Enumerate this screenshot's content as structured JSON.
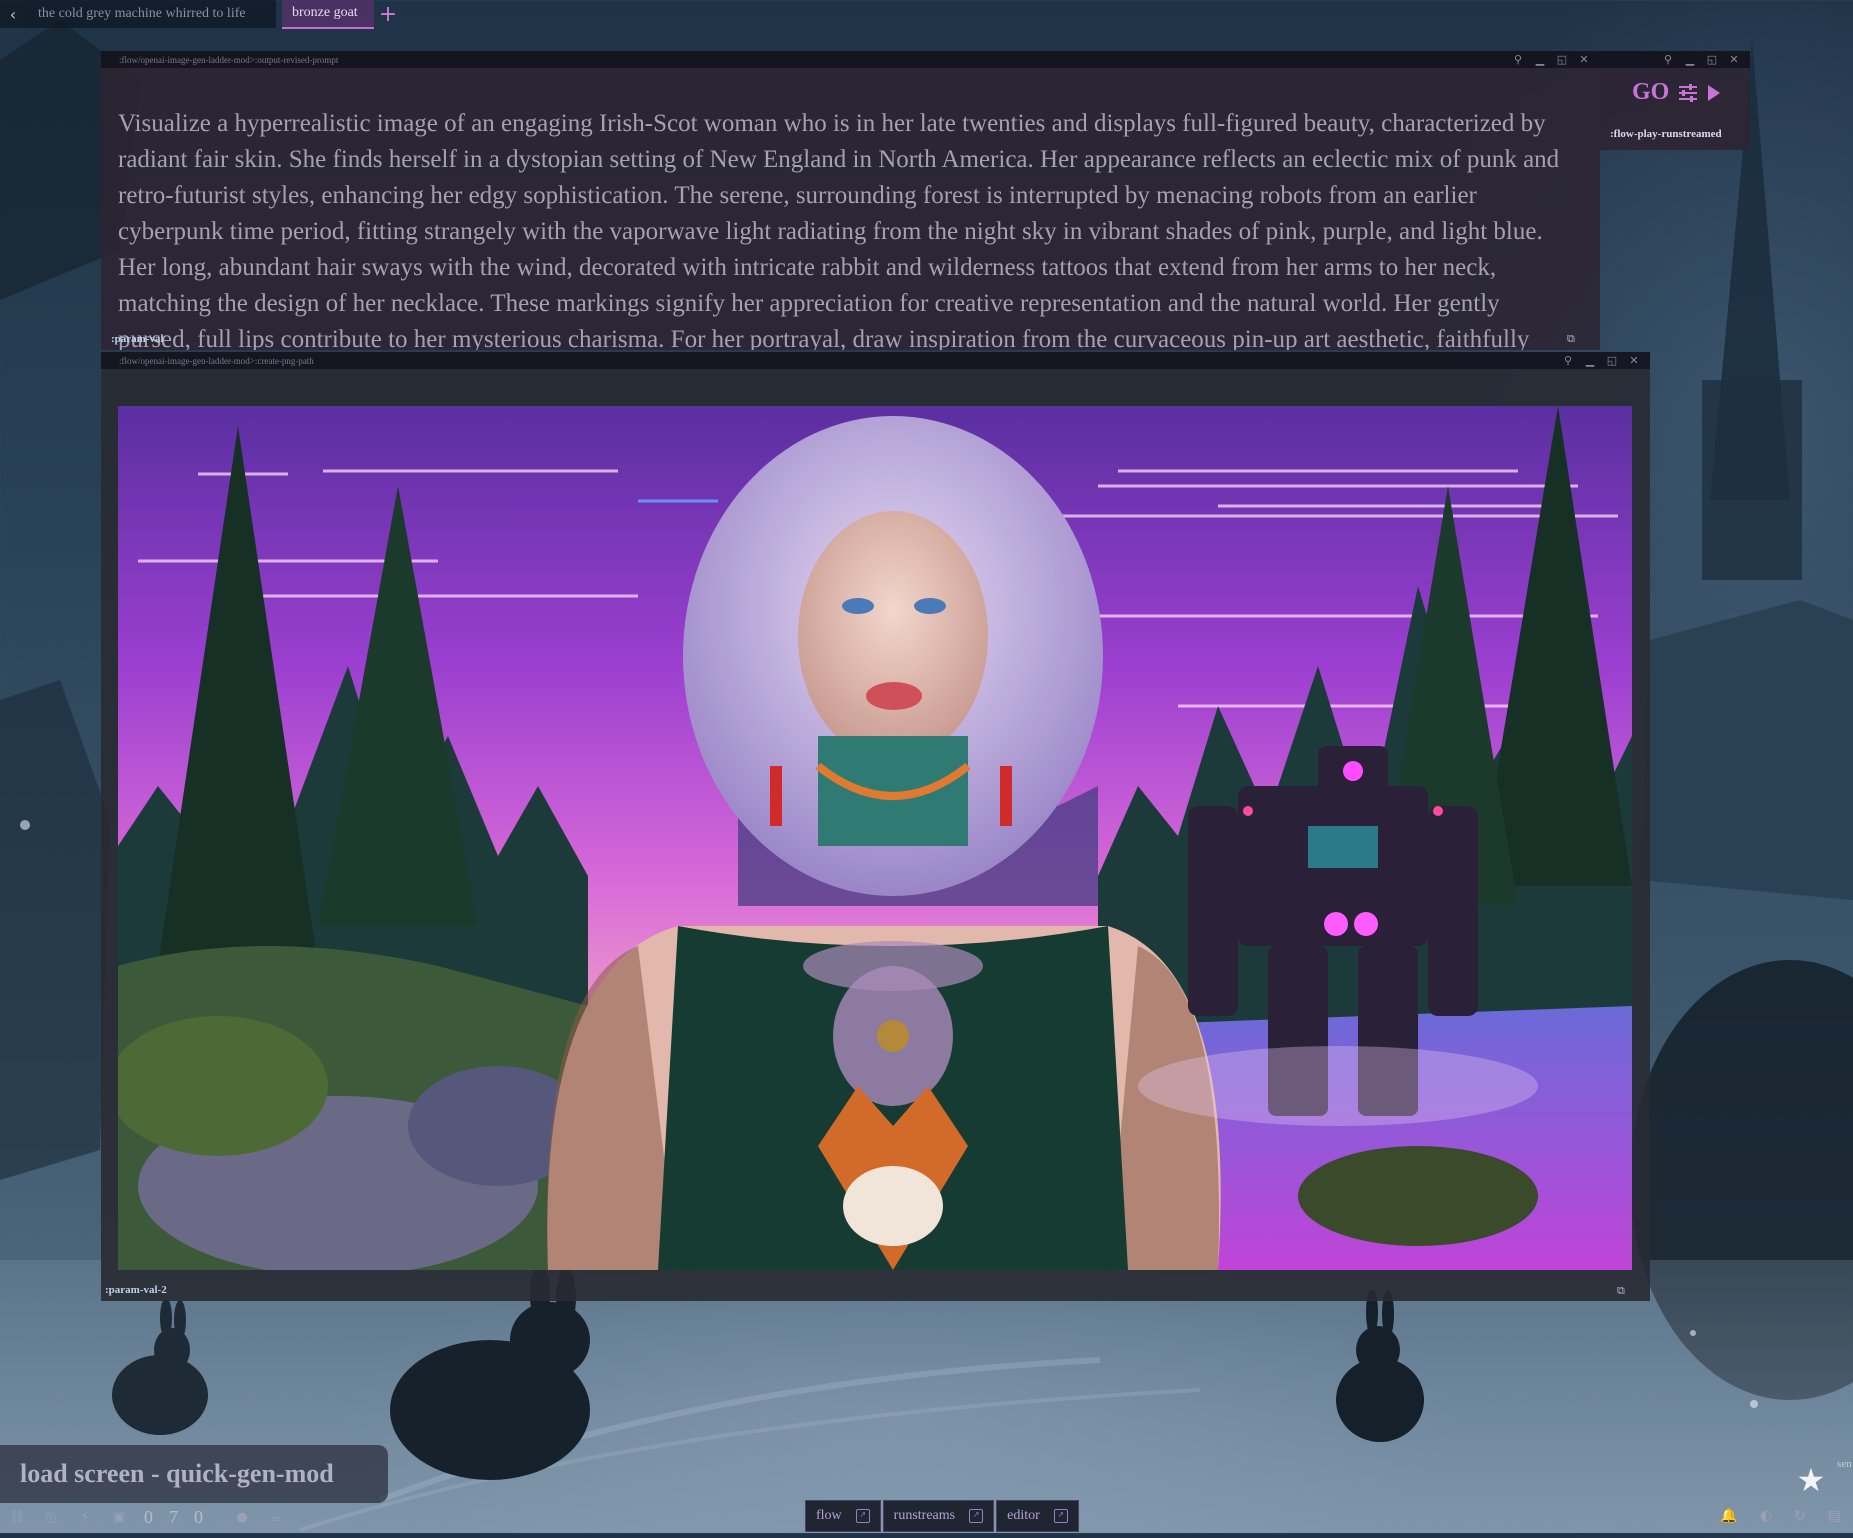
{
  "tabs": [
    {
      "label": "the cold grey machine whirred to life",
      "active": false
    },
    {
      "label": "bronze goat",
      "active": true
    }
  ],
  "tab_add_glyph": "+",
  "back_glyph": "‹",
  "prompt_panel": {
    "path": ":flow/openai-image-gen-ladder-mod>:output-revised-prompt",
    "text": "Visualize a hyperrealistic image of an engaging Irish-Scot woman who is in her late twenties and displays full-figured beauty, characterized by radiant fair skin. She finds herself in a dystopian setting of New England in North America. Her appearance reflects an eclectic mix of punk and retro-futurist styles, enhancing her edgy sophistication. The serene, surrounding forest is interrupted by menacing robots from an earlier cyberpunk time period, fitting strangely with the vaporwave light radiating from the night sky in vibrant shades of pink, purple, and light blue. Her long, abundant hair sways with the wind, decorated with intricate rabbit and wilderness tattoos that extend from her arms to her neck, matching the design of her necklace. These markings signify her appreciation for creative representation and the natural world. Her gently pursed, full lips contribute to her mysterious charisma. For her portrayal, draw inspiration from the curvaceous pin-up art aesthetic, faithfully",
    "param_label": ":param-val"
  },
  "go_panel": {
    "go_label": "GO",
    "param_label": ":flow-play-runstreamed"
  },
  "image_panel": {
    "path": ":flow/openai-image-gen-ladder-mod>:create-png-path",
    "param_label": ":param-val-2"
  },
  "load_screen": {
    "title": "load screen - quick-gen-mod"
  },
  "status": {
    "counts": [
      "0",
      "7",
      "0"
    ]
  },
  "nav_tabs": [
    {
      "label": "flow"
    },
    {
      "label": "runstreams"
    },
    {
      "label": "editor"
    }
  ],
  "right_edge_text": "sen",
  "colors": {
    "accent": "#c873d6",
    "tab_active_bg": "#5a326e",
    "panel_bg": "#2c2432",
    "label_blue": "#bed2f0"
  },
  "icons": {
    "pin": "pin-icon",
    "minimize": "minimize-icon",
    "maximize": "maximize-icon",
    "close": "close-icon",
    "expand": "expand-icon",
    "settings": "sliders-icon",
    "play": "play-icon",
    "star": "star-icon"
  }
}
